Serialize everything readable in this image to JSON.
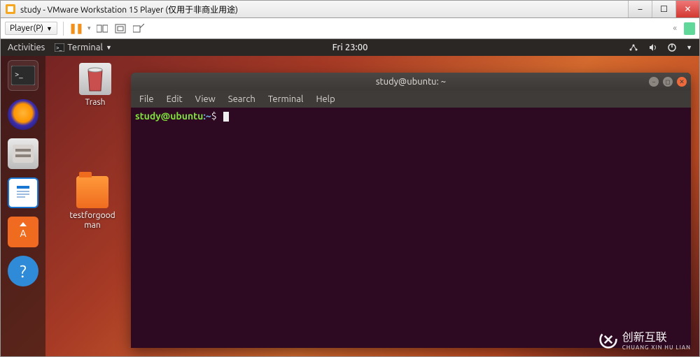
{
  "host_window": {
    "title": "study - VMware Workstation 15 Player (仅用于非商业用途)",
    "buttons": {
      "minimize": "–",
      "maximize": "☐",
      "close": "✕"
    }
  },
  "vmware_toolbar": {
    "player_label": "Player(P)",
    "icons": {
      "pause": "pause-icon",
      "send_cad": "send-ctrl-alt-del-icon",
      "fullscreen": "fullscreen-icon",
      "unity": "unity-icon",
      "back": "«"
    }
  },
  "ubuntu_topbar": {
    "activities": "Activities",
    "app_indicator": "Terminal",
    "clock": "Fri 23:00",
    "status": {
      "network": "network-icon",
      "sound": "sound-icon",
      "power": "power-icon"
    }
  },
  "dock": {
    "items": [
      {
        "name": "terminal",
        "selected": true
      },
      {
        "name": "firefox"
      },
      {
        "name": "files"
      },
      {
        "name": "libreoffice-writer"
      },
      {
        "name": "ubuntu-software"
      },
      {
        "name": "help"
      }
    ]
  },
  "desktop_icons": {
    "trash": "Trash",
    "folder": "testforgoodman"
  },
  "terminal": {
    "title": "study@ubuntu: ~",
    "menu": [
      "File",
      "Edit",
      "View",
      "Search",
      "Terminal",
      "Help"
    ],
    "prompt_userhost": "study@ubuntu",
    "prompt_sep": ":",
    "prompt_path": "~",
    "prompt_symbol": "$"
  },
  "watermark": {
    "main": "创新互联",
    "sub": "CHUANG XIN HU LIAN"
  }
}
